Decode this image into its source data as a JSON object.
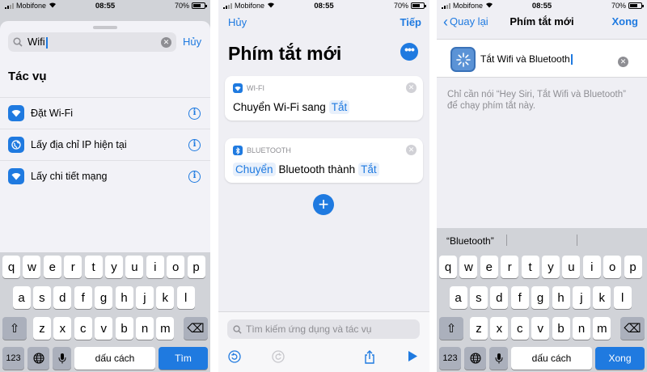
{
  "status": {
    "carrier": "Mobifone",
    "time": "08:55",
    "battery": "70%",
    "battery_level": 0.7
  },
  "panel1": {
    "search_value": "Wifi",
    "cancel_label": "Hủy",
    "section_title": "Tác vụ",
    "actions": [
      {
        "label": "Đặt Wi-Fi",
        "icon": "wifi-icon"
      },
      {
        "label": "Lấy địa chỉ IP hiện tại",
        "icon": "globe-icon"
      },
      {
        "label": "Lấy chi tiết mạng",
        "icon": "wifi-icon"
      }
    ],
    "keyboard": {
      "row1": [
        "q",
        "w",
        "e",
        "r",
        "t",
        "y",
        "u",
        "i",
        "o",
        "p"
      ],
      "row2": [
        "a",
        "s",
        "d",
        "f",
        "g",
        "h",
        "j",
        "k",
        "l"
      ],
      "row3": [
        "z",
        "x",
        "c",
        "v",
        "b",
        "n",
        "m"
      ],
      "numbers_key": "123",
      "space_key": "dấu cách",
      "return_key": "Tìm"
    }
  },
  "panel2": {
    "cancel_label": "Hủy",
    "next_label": "Tiếp",
    "title": "Phím tắt mới",
    "wifi_card": {
      "header": "WI-FI",
      "text": "Chuyển Wi-Fi sang",
      "value": "Tắt"
    },
    "bluetooth_card": {
      "header": "BLUETOOTH",
      "verb": "Chuyển",
      "text": "Bluetooth thành",
      "value": "Tắt"
    },
    "search_placeholder": "Tìm kiếm ứng dụng và tác vụ"
  },
  "panel3": {
    "back_label": "Quay lại",
    "title": "Phím tắt mới",
    "done_label": "Xong",
    "shortcut_name": "Tắt Wifi và Bluetooth",
    "hint": "Chỉ cần nói “Hey Siri, Tắt Wifi và Bluetooth” để chạy phím tắt này.",
    "prediction": "“Bluetooth”",
    "keyboard": {
      "numbers_key": "123",
      "space_key": "dấu cách",
      "return_key": "Xong"
    }
  },
  "colors": {
    "accent": "#1f7ae0",
    "keyboard_bg": "#d1d3d8",
    "background": "#efeff4"
  }
}
